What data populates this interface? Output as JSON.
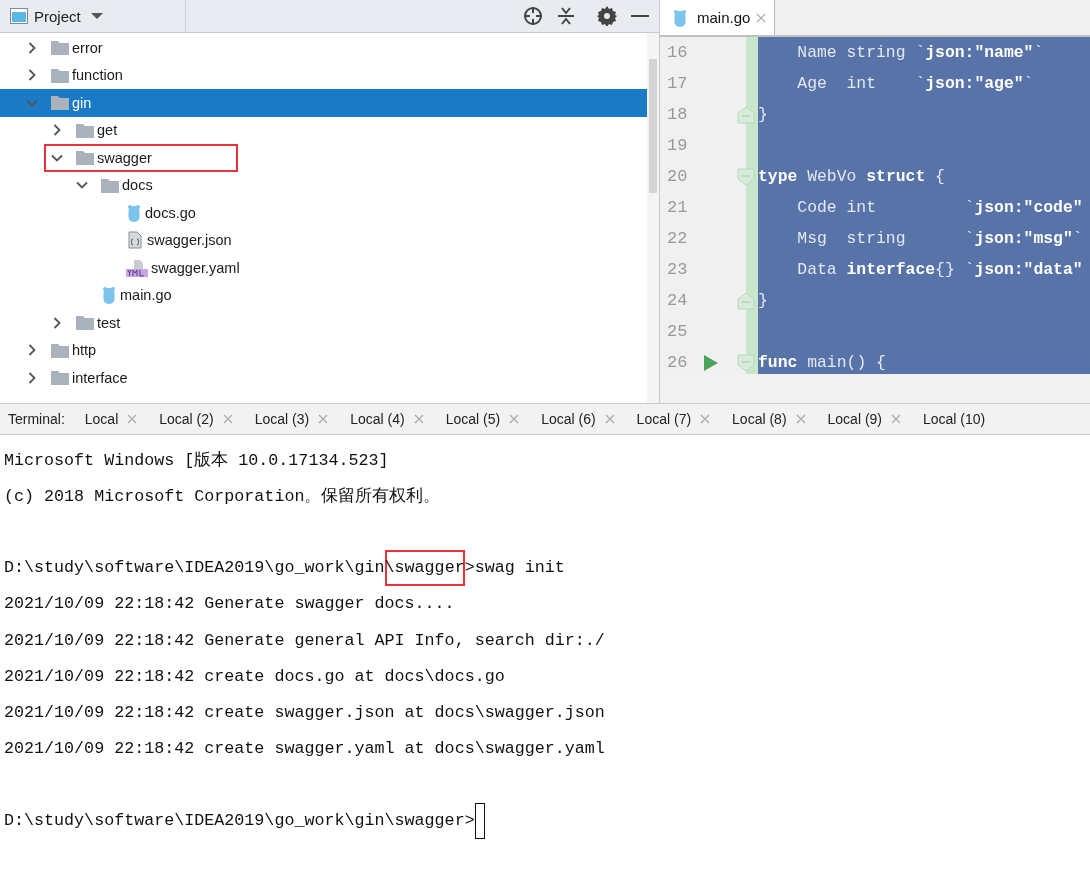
{
  "project_panel": {
    "title": "Project",
    "tree": [
      {
        "name": "error",
        "kind": "folder",
        "expanded": false,
        "selected": false,
        "highlighted": false
      },
      {
        "name": "function",
        "kind": "folder",
        "expanded": false,
        "selected": false,
        "highlighted": false
      },
      {
        "name": "gin",
        "kind": "folder",
        "expanded": true,
        "selected": true,
        "highlighted": false,
        "children": [
          {
            "name": "get",
            "kind": "folder",
            "expanded": false,
            "selected": false,
            "highlighted": false
          },
          {
            "name": "swagger",
            "kind": "folder",
            "expanded": true,
            "selected": false,
            "highlighted": true,
            "children": [
              {
                "name": "docs",
                "kind": "folder",
                "expanded": true,
                "selected": false,
                "highlighted": false,
                "children": [
                  {
                    "name": "docs.go",
                    "kind": "go",
                    "selected": false,
                    "highlighted": false
                  },
                  {
                    "name": "swagger.json",
                    "kind": "json",
                    "selected": false,
                    "highlighted": false
                  },
                  {
                    "name": "swagger.yaml",
                    "kind": "yaml",
                    "selected": false,
                    "highlighted": false
                  }
                ]
              },
              {
                "name": "main.go",
                "kind": "go",
                "selected": false,
                "highlighted": false
              }
            ]
          },
          {
            "name": "test",
            "kind": "folder",
            "expanded": false,
            "selected": false,
            "highlighted": false
          }
        ]
      },
      {
        "name": "http",
        "kind": "folder",
        "expanded": false,
        "selected": false,
        "highlighted": false
      },
      {
        "name": "interface",
        "kind": "folder",
        "expanded": false,
        "selected": false,
        "highlighted": false
      }
    ]
  },
  "editor": {
    "tabs": [
      {
        "label": "main.go",
        "selected": true
      }
    ],
    "lines": [
      {
        "number": "16",
        "kind": "plain",
        "run": false,
        "tokens": [
          {
            "text": "    Name string `",
            "bold": false
          },
          {
            "text": "json:\"name\"",
            "bold": true
          },
          {
            "text": "`",
            "bold": false
          }
        ]
      },
      {
        "number": "17",
        "kind": "plain",
        "run": false,
        "tokens": [
          {
            "text": "    Age  int    `",
            "bold": false
          },
          {
            "text": "json:\"age\"",
            "bold": true
          },
          {
            "text": "`",
            "bold": false
          }
        ]
      },
      {
        "number": "18",
        "kind": "fold-end",
        "run": false,
        "tokens": [
          {
            "text": "}",
            "bold": false
          }
        ]
      },
      {
        "number": "19",
        "kind": "plain",
        "run": false
      },
      {
        "number": "20",
        "kind": "fold-start",
        "run": false,
        "tokens": [
          {
            "text": "type",
            "bold": true
          },
          {
            "text": " WebVo ",
            "bold": false
          },
          {
            "text": "struct",
            "bold": true
          },
          {
            "text": " {",
            "bold": false
          }
        ]
      },
      {
        "number": "21",
        "kind": "plain",
        "run": false,
        "tokens": [
          {
            "text": "    Code int         `",
            "bold": false
          },
          {
            "text": "json:\"code\"",
            "bold": true
          }
        ]
      },
      {
        "number": "22",
        "kind": "plain",
        "run": false,
        "tokens": [
          {
            "text": "    Msg  string      `",
            "bold": false
          },
          {
            "text": "json:\"msg\"",
            "bold": true
          },
          {
            "text": "`",
            "bold": false
          }
        ]
      },
      {
        "number": "23",
        "kind": "plain",
        "run": false,
        "tokens": [
          {
            "text": "    Data ",
            "bold": false
          },
          {
            "text": "interface",
            "bold": true
          },
          {
            "text": "{} `",
            "bold": false
          },
          {
            "text": "json:\"data\"",
            "bold": true
          }
        ]
      },
      {
        "number": "24",
        "kind": "fold-end",
        "run": false,
        "tokens": [
          {
            "text": "}",
            "bold": false
          }
        ]
      },
      {
        "number": "25",
        "kind": "plain",
        "run": false
      },
      {
        "number": "26",
        "kind": "fold-start",
        "run": true,
        "tokens": [
          {
            "text": "func",
            "bold": true
          },
          {
            "text": " main() {",
            "bold": false
          }
        ]
      }
    ]
  },
  "terminal": {
    "title": "Terminal:",
    "tabs": [
      {
        "label": "Local",
        "selected": false
      },
      {
        "label": "Local (2)",
        "selected": false
      },
      {
        "label": "Local (3)",
        "selected": false
      },
      {
        "label": "Local (4)",
        "selected": false
      },
      {
        "label": "Local (5)",
        "selected": false
      },
      {
        "label": "Local (6)",
        "selected": false
      },
      {
        "label": "Local (7)",
        "selected": false
      },
      {
        "label": "Local (8)",
        "selected": false
      },
      {
        "label": "Local (9)",
        "selected": false
      },
      {
        "label": "Local (10)",
        "selected": false
      }
    ],
    "lines": [
      {
        "kind": "output",
        "segments": [
          {
            "text": "Microsoft Windows [版本 10.0.17134.523]",
            "highlighted": false
          }
        ]
      },
      {
        "kind": "output",
        "segments": [
          {
            "text": "(c) 2018 Microsoft Corporation。保留所有权利。",
            "highlighted": false
          }
        ]
      },
      {
        "kind": "blank"
      },
      {
        "kind": "output",
        "segments": [
          {
            "text": "D:\\study\\software\\IDEA2019\\go_work\\gin",
            "highlighted": false
          },
          {
            "text": "\\swagger",
            "highlighted": true
          },
          {
            "text": ">swag init",
            "highlighted": false
          }
        ]
      },
      {
        "kind": "output",
        "segments": [
          {
            "text": "2021/10/09 22:18:42 Generate swagger docs....",
            "highlighted": false
          }
        ]
      },
      {
        "kind": "output",
        "segments": [
          {
            "text": "2021/10/09 22:18:42 Generate general API Info, search dir:./",
            "highlighted": false
          }
        ]
      },
      {
        "kind": "output",
        "segments": [
          {
            "text": "2021/10/09 22:18:42 create docs.go at docs\\docs.go",
            "highlighted": false
          }
        ]
      },
      {
        "kind": "output",
        "segments": [
          {
            "text": "2021/10/09 22:18:42 create swagger.json at docs\\swagger.json",
            "highlighted": false
          }
        ]
      },
      {
        "kind": "output",
        "segments": [
          {
            "text": "2021/10/09 22:18:42 create swagger.yaml at docs\\swagger.yaml",
            "highlighted": false
          }
        ]
      },
      {
        "kind": "blank"
      },
      {
        "kind": "prompt",
        "segments": [
          {
            "text": "D:\\study\\software\\IDEA2019\\go_work\\gin\\swagger>",
            "highlighted": false
          }
        ]
      }
    ]
  }
}
